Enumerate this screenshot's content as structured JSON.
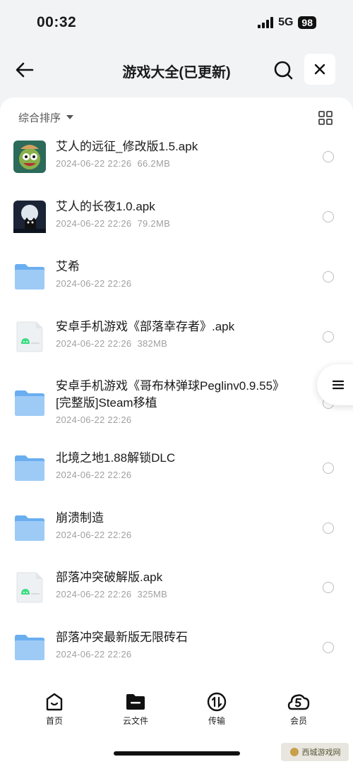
{
  "status_bar": {
    "time": "00:32",
    "network": "5G",
    "battery": "98"
  },
  "header": {
    "title": "游戏大全(已更新)"
  },
  "toolbar": {
    "sort_label": "综合排序"
  },
  "files": [
    {
      "name": "艾人的远征_修改版1.5.apk",
      "date": "2024-06-22 22:26",
      "size": "66.2MB",
      "icon": "game-thumbnail-icon"
    },
    {
      "name": "艾人的长夜1.0.apk",
      "date": "2024-06-22 22:26",
      "size": "79.2MB",
      "icon": "game-thumbnail-icon"
    },
    {
      "name": "艾希",
      "date": "2024-06-22 22:26",
      "size": "",
      "icon": "folder-icon"
    },
    {
      "name": "安卓手机游戏《部落幸存者》.apk",
      "date": "2024-06-22 22:26",
      "size": "382MB",
      "icon": "apk-file-icon"
    },
    {
      "name": "安卓手机游戏《哥布林弹球Peglinv0.9.55》[完整版]Steam移植",
      "date": "2024-06-22 22:26",
      "size": "",
      "icon": "folder-icon"
    },
    {
      "name": "北境之地1.88解锁DLC",
      "date": "2024-06-22 22:26",
      "size": "",
      "icon": "folder-icon"
    },
    {
      "name": "崩溃制造",
      "date": "2024-06-22 22:26",
      "size": "",
      "icon": "folder-icon"
    },
    {
      "name": "部落冲突破解版.apk",
      "date": "2024-06-22 22:26",
      "size": "325MB",
      "icon": "apk-file-icon"
    },
    {
      "name": "部落冲突最新版无限砖石",
      "date": "2024-06-22 22:26",
      "size": "",
      "icon": "folder-icon"
    }
  ],
  "tabs": [
    {
      "label": "首页",
      "icon": "home-icon"
    },
    {
      "label": "云文件",
      "icon": "folder-icon"
    },
    {
      "label": "传输",
      "icon": "transfer-icon"
    },
    {
      "label": "会员",
      "icon": "vip-icon"
    }
  ],
  "watermark": {
    "text": "西城游戏网"
  },
  "colors": {
    "folder": "#6aaef0",
    "folder_light": "#9ecbf6",
    "apk_green": "#3ddc84",
    "panel": "#ffffff",
    "background": "#f2f3f5"
  }
}
